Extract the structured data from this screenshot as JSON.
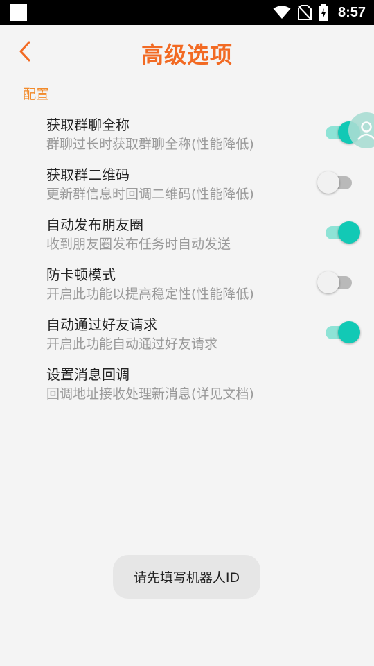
{
  "status_bar": {
    "time": "8:57",
    "icons": [
      "notification-square-icon",
      "wifi-icon",
      "no-sim-icon",
      "battery-charging-icon"
    ]
  },
  "app_bar": {
    "title": "高级选项",
    "back_icon": "chevron-left-icon"
  },
  "section": {
    "header": "配置"
  },
  "settings": [
    {
      "title": "获取群聊全称",
      "description": "群聊过长时获取群聊全称(性能降低)",
      "toggle": "on"
    },
    {
      "title": "获取群二维码",
      "description": "更新群信息时回调二维码(性能降低)",
      "toggle": "off"
    },
    {
      "title": "自动发布朋友圈",
      "description": "收到朋友圈发布任务时自动发送",
      "toggle": "on"
    },
    {
      "title": "防卡顿模式",
      "description": "开启此功能以提高稳定性(性能降低)",
      "toggle": "off"
    },
    {
      "title": "自动通过好友请求",
      "description": "开启此功能自动通过好友请求",
      "toggle": "on"
    },
    {
      "title": "设置消息回调",
      "description": "回调地址接收处理新消息(详见文档)",
      "toggle": null
    }
  ],
  "floating_button": {
    "icon": "person-icon"
  },
  "toast": {
    "message": "请先填写机器人ID"
  },
  "colors": {
    "accent": "#f26a23",
    "section_header": "#f28a2a",
    "toggle_on": "#12c9b5",
    "toggle_on_track": "#8ee3d6",
    "toggle_off_track": "#b9b9b9",
    "background": "#f4f4f4"
  }
}
